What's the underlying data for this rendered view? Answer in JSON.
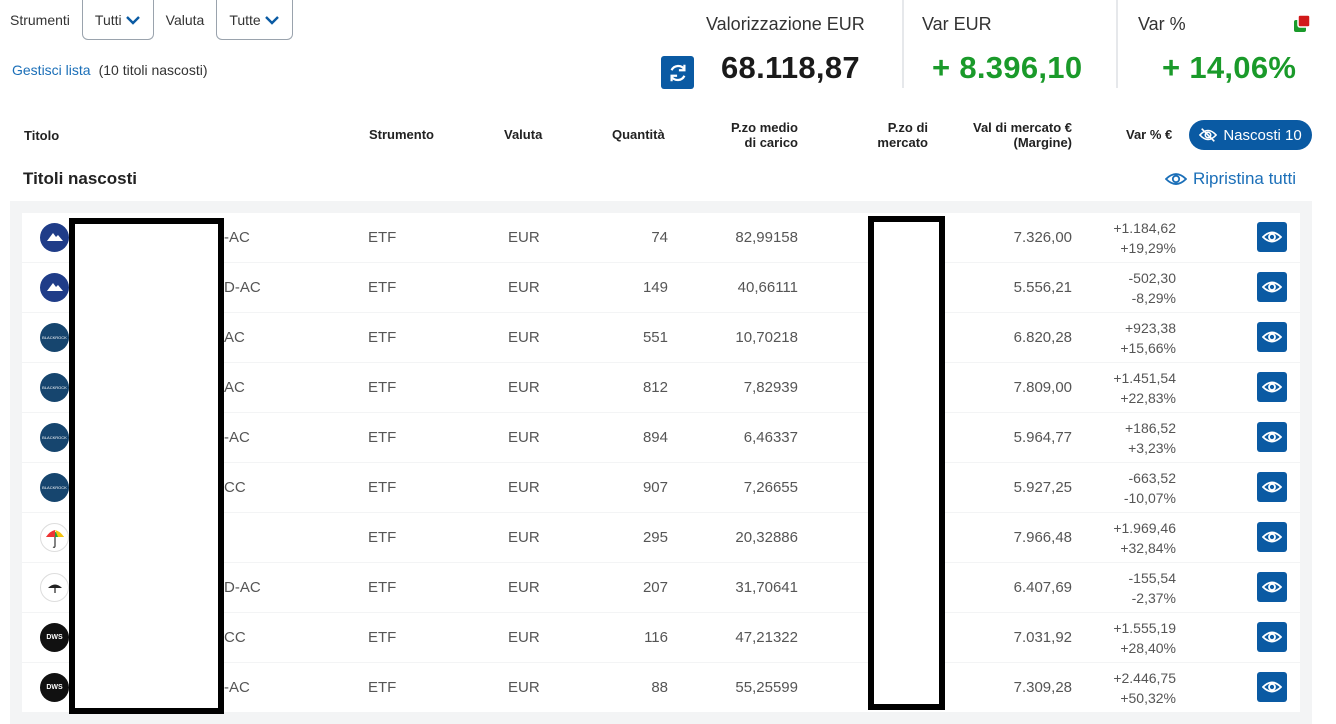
{
  "filters": {
    "instruments_label": "Strumenti",
    "instruments_value": "Tutti",
    "currency_label": "Valuta",
    "currency_value": "Tutte"
  },
  "manage": {
    "link": "Gestisci lista",
    "hidden_note": "(10 titoli nascosti)"
  },
  "summary": {
    "valuation_label": "Valorizzazione EUR",
    "valuation_value": "68.118,87",
    "var_eur_label": "Var EUR",
    "var_eur_value": "+ 8.396,10",
    "var_pct_label": "Var %",
    "var_pct_value": "+ 14,06%",
    "positive_color": "#1a9a2a"
  },
  "columns": {
    "title": "Titolo",
    "instrument": "Strumento",
    "currency": "Valuta",
    "quantity": "Quantità",
    "avg_price_1": "P.zo medio",
    "avg_price_2": "di carico",
    "market_price_1": "P.zo di",
    "market_price_2": "mercato",
    "market_value_1": "Val di mercato €",
    "market_value_2": "(Margine)",
    "var": "Var % €"
  },
  "hidden_button": "Nascosti 10",
  "section_title": "Titoli nascosti",
  "restore_all": "Ripristina tutti",
  "rows": [
    {
      "logo": "invesco",
      "name_suffix": "-AC",
      "instrument": "ETF",
      "currency": "EUR",
      "quantity": "74",
      "avg_price": "82,99158",
      "market_value": "7.326,00",
      "var_eur": "+1.184,62",
      "var_pct": "+19,29%"
    },
    {
      "logo": "invesco",
      "name_suffix": "D-AC",
      "instrument": "ETF",
      "currency": "EUR",
      "quantity": "149",
      "avg_price": "40,66111",
      "market_value": "5.556,21",
      "var_eur": "-502,30",
      "var_pct": "-8,29%"
    },
    {
      "logo": "blackrock",
      "name_suffix": "AC",
      "instrument": "ETF",
      "currency": "EUR",
      "quantity": "551",
      "avg_price": "10,70218",
      "market_value": "6.820,28",
      "var_eur": "+923,38",
      "var_pct": "+15,66%"
    },
    {
      "logo": "blackrock",
      "name_suffix": "AC",
      "instrument": "ETF",
      "currency": "EUR",
      "quantity": "812",
      "avg_price": "7,82939",
      "market_value": "7.809,00",
      "var_eur": "+1.451,54",
      "var_pct": "+22,83%"
    },
    {
      "logo": "blackrock",
      "name_suffix": "-AC",
      "instrument": "ETF",
      "currency": "EUR",
      "quantity": "894",
      "avg_price": "6,46337",
      "market_value": "5.964,77",
      "var_eur": "+186,52",
      "var_pct": "+3,23%"
    },
    {
      "logo": "blackrock",
      "name_suffix": "CC",
      "instrument": "ETF",
      "currency": "EUR",
      "quantity": "907",
      "avg_price": "7,26655",
      "market_value": "5.927,25",
      "var_eur": "-663,52",
      "var_pct": "-10,07%"
    },
    {
      "logo": "generali",
      "name_suffix": "",
      "instrument": "ETF",
      "currency": "EUR",
      "quantity": "295",
      "avg_price": "20,32886",
      "market_value": "7.966,48",
      "var_eur": "+1.969,46",
      "var_pct": "+32,84%"
    },
    {
      "logo": "wisdom",
      "name_suffix": "D-AC",
      "instrument": "ETF",
      "currency": "EUR",
      "quantity": "207",
      "avg_price": "31,70641",
      "market_value": "6.407,69",
      "var_eur": "-155,54",
      "var_pct": "-2,37%"
    },
    {
      "logo": "dws",
      "name_suffix": "CC",
      "instrument": "ETF",
      "currency": "EUR",
      "quantity": "116",
      "avg_price": "47,21322",
      "market_value": "7.031,92",
      "var_eur": "+1.555,19",
      "var_pct": "+28,40%"
    },
    {
      "logo": "dws",
      "name_suffix": "-AC",
      "instrument": "ETF",
      "currency": "EUR",
      "quantity": "88",
      "avg_price": "55,25599",
      "market_value": "7.309,28",
      "var_eur": "+2.446,75",
      "var_pct": "+50,32%"
    }
  ],
  "colors": {
    "primary": "#0a5aa3",
    "link": "#1b6fb8",
    "positive": "#1a9a2a"
  }
}
